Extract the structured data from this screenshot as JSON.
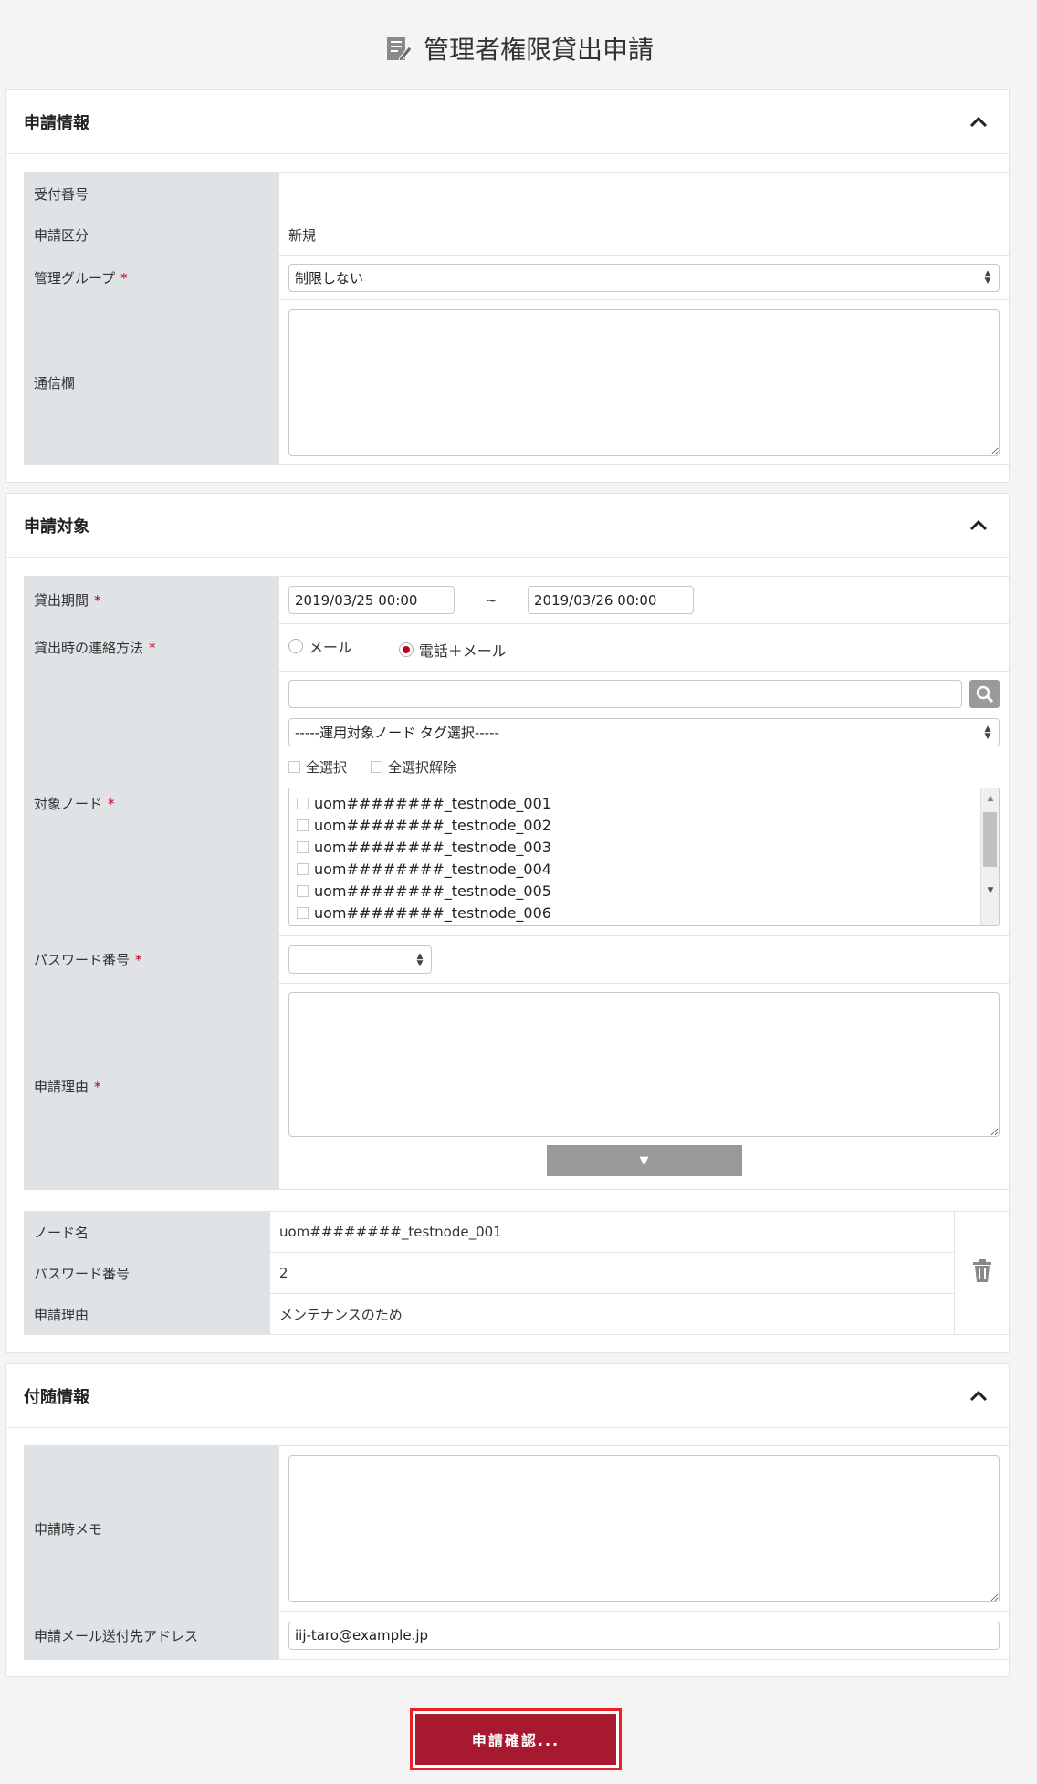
{
  "page": {
    "title": "管理者権限貸出申請"
  },
  "sections": {
    "info": {
      "title": "申請情報",
      "labels": {
        "receipt_no": "受付番号",
        "category": "申請区分",
        "group": "管理グループ",
        "comm": "通信欄"
      },
      "values": {
        "receipt_no": "",
        "category": "新規",
        "group": "制限しない"
      },
      "required_mark": "*"
    },
    "target": {
      "title": "申請対象",
      "labels": {
        "period": "貸出期間",
        "contact": "貸出時の連絡方法",
        "nodes": "対象ノード",
        "pw_no": "パスワード番号",
        "reason": "申請理由"
      },
      "period_from": "2019/03/25 00:00",
      "period_sep": "~",
      "period_to": "2019/03/26 00:00",
      "contact_options": [
        "メール",
        "電話＋メール"
      ],
      "contact_selected": "電話＋メール",
      "tag_select": "-----運用対象ノード タグ選択-----",
      "select_all": "全選択",
      "deselect_all": "全選択解除",
      "node_list": [
        "uom########_testnode_001",
        "uom########_testnode_002",
        "uom########_testnode_003",
        "uom########_testnode_004",
        "uom########_testnode_005",
        "uom########_testnode_006"
      ],
      "expand_symbol": "▼",
      "entries": [
        {
          "node_label": "ノード名",
          "node": "uom########_testnode_001",
          "pw_label": "パスワード番号",
          "pw": "2",
          "reason_label": "申請理由",
          "reason": "メンテナンスのため"
        }
      ]
    },
    "extra": {
      "title": "付随情報",
      "labels": {
        "memo": "申請時メモ",
        "mail": "申請メール送付先アドレス"
      },
      "mail_value": "iij-taro@example.jp"
    }
  },
  "submit_label": "申請確認...",
  "icons": {
    "title": "document-edit-icon",
    "collapse": "chevron-up-icon",
    "search": "search-icon",
    "delete": "trash-icon"
  },
  "colors": {
    "accent": "#a6192e",
    "required": "#c0001c",
    "label_bg": "#dfe3e5"
  }
}
